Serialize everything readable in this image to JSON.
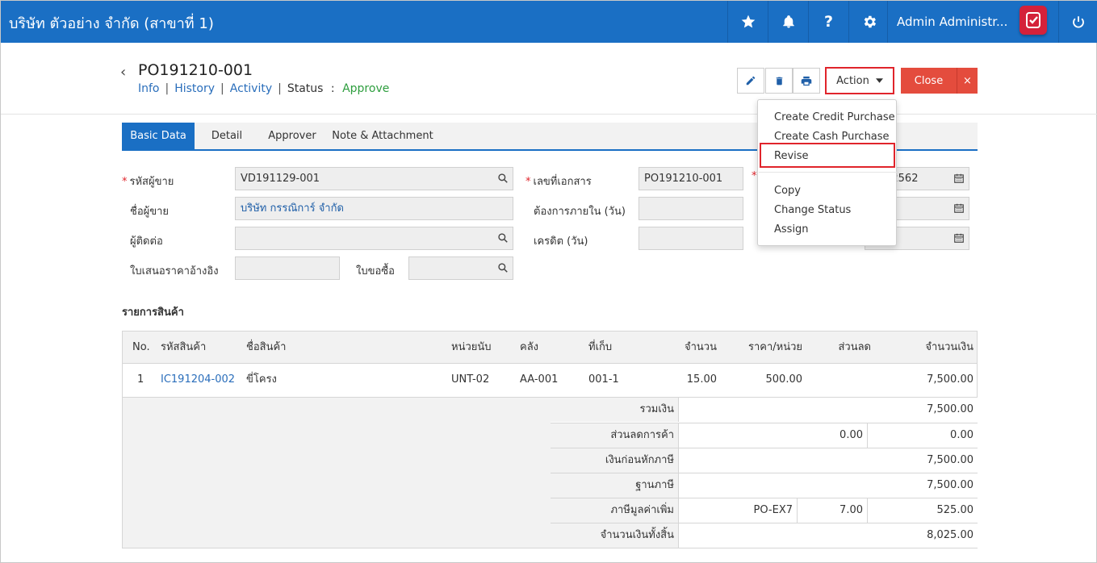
{
  "topbar": {
    "company": "บริษัท ตัวอย่าง จำกัด (สาขาที่ 1)",
    "user": "Admin Administr..."
  },
  "doc": {
    "number": "PO191210-001",
    "nav": {
      "info": "Info",
      "history": "History",
      "activity": "Activity",
      "status_label": "Status",
      "status_sep": ":",
      "status_value": "Approve"
    },
    "action_label": "Action",
    "close_label": "Close",
    "close_x": "×"
  },
  "action_menu": {
    "items": [
      "Create Credit Purchase",
      "Create Cash Purchase",
      "Revise",
      "Copy",
      "Change Status",
      "Assign"
    ],
    "highlighted": "Revise"
  },
  "tabs": [
    "Basic Data",
    "Detail",
    "Approver",
    "Note & Attachment"
  ],
  "form": {
    "vendor_code_label": "รหัสผู้ขาย",
    "vendor_code": "VD191129-001",
    "vendor_name_label": "ชื่อผู้ขาย",
    "vendor_name": "บริษัท กรรณิการ์ จำกัด",
    "contact_label": "ผู้ติดต่อ",
    "contact": "",
    "quotation_ref_label": "ใบเสนอราคาอ้างอิง",
    "quotation_ref": "",
    "purchase_request_label": "ใบขอซื้อ",
    "purchase_request": "",
    "doc_no_label": "เลขที่เอกสาร",
    "doc_no": "PO191210-001",
    "required_within_label": "ต้องการภายใน (วัน)",
    "required_within": "",
    "credit_label": "เครดิต (วัน)",
    "credit": "",
    "date_partial": "/2562"
  },
  "items_section": {
    "title": "รายการสินค้า",
    "columns": [
      "No.",
      "รหัสสินค้า",
      "ชื่อสินค้า",
      "หน่วยนับ",
      "คลัง",
      "ที่เก็บ",
      "จำนวน",
      "ราคา/หน่วย",
      "ส่วนลด",
      "จำนวนเงิน"
    ],
    "rows": [
      {
        "no": "1",
        "code": "IC191204-002",
        "name": "ขี่โครง",
        "unit": "UNT-02",
        "warehouse": "AA-001",
        "location": "001-1",
        "qty": "15.00",
        "price": "500.00",
        "discount": "",
        "amount": "7,500.00"
      }
    ]
  },
  "totals": {
    "subtotal_label": "รวมเงิน",
    "subtotal": "7,500.00",
    "trade_discount_label": "ส่วนลดการค้า",
    "trade_discount_pct": "0.00",
    "trade_discount": "0.00",
    "before_tax_label": "เงินก่อนหักภาษี",
    "before_tax": "7,500.00",
    "tax_base_label": "ฐานภาษี",
    "tax_base": "7,500.00",
    "vat_label": "ภาษีมูลค่าเพิ่ม",
    "vat_code": "PO-EX7",
    "vat_rate": "7.00",
    "vat": "525.00",
    "grand_total_label": "จำนวนเงินทั้งสิ้น",
    "grand_total": "8,025.00"
  },
  "colors": {
    "topbar": "#1a6fc4",
    "close_button": "#e44c3d",
    "highlight": "#e0242b",
    "approve": "#2e9e3e"
  }
}
